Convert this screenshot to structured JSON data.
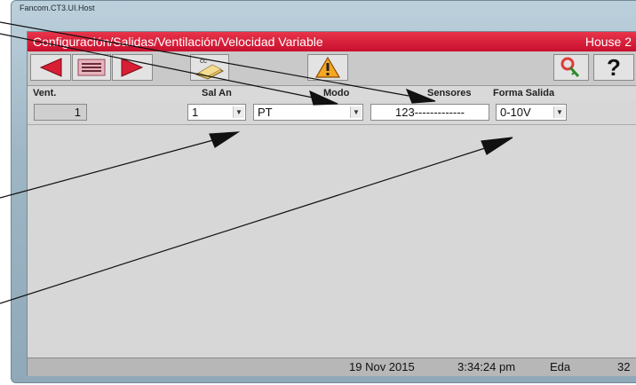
{
  "window": {
    "title": "Fancom.CT3.UI.Host"
  },
  "header": {
    "title": "Configuración/Salidas/Ventilación/Velocidad Variable",
    "house": "House 2"
  },
  "toolbar": {
    "icons": [
      "arrow-left-icon",
      "list-icon",
      "arrow-right-icon",
      "copy-icon",
      "warning-icon",
      "key-icon",
      "help-icon"
    ],
    "copy_label": "cc",
    "help_label": "?"
  },
  "table": {
    "headers": {
      "vent": "Vent.",
      "sal_an": "Sal An",
      "modo": "Modo",
      "sensores": "Sensores",
      "forma_salida": "Forma Salida"
    },
    "rows": [
      {
        "vent": "1",
        "sal_an": "1",
        "modo": "PT",
        "sensores": "123-------------",
        "forma_salida": "0-10V"
      }
    ]
  },
  "status": {
    "date": "19 Nov 2015",
    "time": "3:34:24 pm",
    "user": "Eda",
    "number": "32"
  },
  "colors": {
    "title_bar": "#c8102e",
    "arrow": "#d81e35",
    "client_bg": "#d7d7d7"
  }
}
